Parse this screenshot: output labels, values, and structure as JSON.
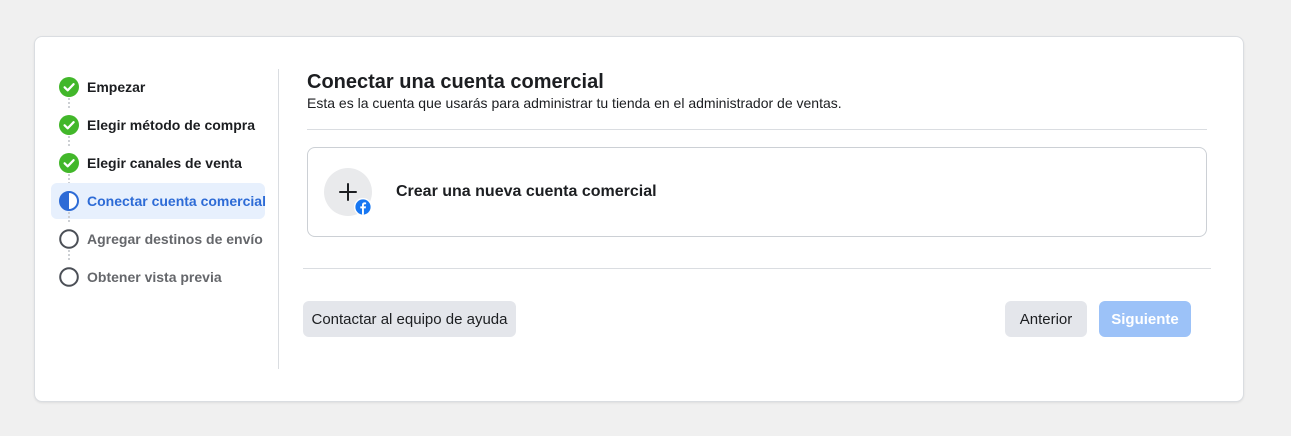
{
  "colors": {
    "page_bg": "#f0f0f0",
    "check_green": "#42b72a",
    "accent_blue": "#2d6bd6",
    "current_step_bg": "#e7f0fd",
    "next_disabled": "#9cc2f8",
    "facebook_blue": "#1877f2"
  },
  "steps": [
    {
      "label": "Empezar",
      "state": "done",
      "icon": "check-circle-icon"
    },
    {
      "label": "Elegir método de compra",
      "state": "done",
      "icon": "check-circle-icon"
    },
    {
      "label": "Elegir canales de venta",
      "state": "done",
      "icon": "check-circle-icon"
    },
    {
      "label": "Conectar cuenta comercial",
      "state": "current",
      "icon": "half-circle-icon"
    },
    {
      "label": "Agregar destinos de envío",
      "state": "todo",
      "icon": "empty-circle-icon"
    },
    {
      "label": "Obtener vista previa",
      "state": "todo",
      "icon": "empty-circle-icon"
    }
  ],
  "main": {
    "title": "Conectar una cuenta comercial",
    "subtitle": "Esta es la cuenta que usarás para administrar tu tienda en el administrador de ventas.",
    "option": {
      "label": "Crear una nueva cuenta comercial",
      "icon": "plus-icon",
      "badge_icon": "facebook-icon"
    }
  },
  "footer": {
    "help_label": "Contactar al equipo de ayuda",
    "prev_label": "Anterior",
    "next_label": "Siguiente"
  }
}
